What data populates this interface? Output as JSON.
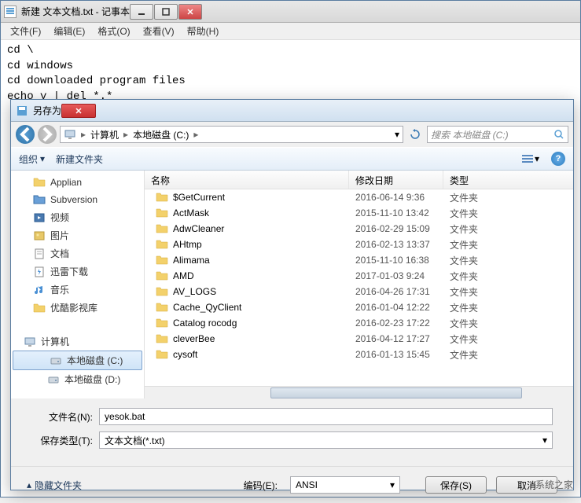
{
  "notepad": {
    "title": "新建 文本文档.txt - 记事本",
    "menu": {
      "file": "文件(F)",
      "edit": "编辑(E)",
      "format": "格式(O)",
      "view": "查看(V)",
      "help": "帮助(H)"
    },
    "content": "cd \\\ncd windows\ncd downloaded program files\necho y | del *.*"
  },
  "dialog": {
    "title": "另存为",
    "breadcrumb": {
      "computer": "计算机",
      "disk": "本地磁盘 (C:)"
    },
    "search_placeholder": "搜索 本地磁盘 (C:)",
    "toolbar": {
      "organize": "组织",
      "newfolder": "新建文件夹"
    },
    "sidebar": {
      "items": [
        {
          "label": "Applian",
          "icon": "folder"
        },
        {
          "label": "Subversion",
          "icon": "folder-blue"
        },
        {
          "label": "视频",
          "icon": "video"
        },
        {
          "label": "图片",
          "icon": "picture"
        },
        {
          "label": "文档",
          "icon": "document"
        },
        {
          "label": "迅雷下载",
          "icon": "thunder"
        },
        {
          "label": "音乐",
          "icon": "music"
        },
        {
          "label": "优酷影视库",
          "icon": "folder"
        }
      ],
      "computer": "计算机",
      "disks": [
        {
          "label": "本地磁盘 (C:)",
          "selected": true
        },
        {
          "label": "本地磁盘 (D:)",
          "selected": false
        }
      ]
    },
    "columns": {
      "name": "名称",
      "date": "修改日期",
      "type": "类型"
    },
    "files": [
      {
        "name": "$GetCurrent",
        "date": "2016-06-14 9:36",
        "type": "文件夹"
      },
      {
        "name": "ActMask",
        "date": "2015-11-10 13:42",
        "type": "文件夹"
      },
      {
        "name": "AdwCleaner",
        "date": "2016-02-29 15:09",
        "type": "文件夹"
      },
      {
        "name": "AHtmp",
        "date": "2016-02-13 13:37",
        "type": "文件夹"
      },
      {
        "name": "Alimama",
        "date": "2015-11-10 16:38",
        "type": "文件夹"
      },
      {
        "name": "AMD",
        "date": "2017-01-03 9:24",
        "type": "文件夹"
      },
      {
        "name": "AV_LOGS",
        "date": "2016-04-26 17:31",
        "type": "文件夹"
      },
      {
        "name": "Cache_QyClient",
        "date": "2016-01-04 12:22",
        "type": "文件夹"
      },
      {
        "name": "Catalog rocodg",
        "date": "2016-02-23 17:22",
        "type": "文件夹"
      },
      {
        "name": "cleverBee",
        "date": "2016-04-12 17:27",
        "type": "文件夹"
      },
      {
        "name": "cysoft",
        "date": "2016-01-13 15:45",
        "type": "文件夹"
      }
    ],
    "form": {
      "filename_label": "文件名(N):",
      "filename_value": "yesok.bat",
      "filetype_label": "保存类型(T):",
      "filetype_value": "文本文档(*.txt)",
      "hide_folders": "隐藏文件夹",
      "encoding_label": "编码(E):",
      "encoding_value": "ANSI",
      "save": "保存(S)",
      "cancel": "取消"
    }
  },
  "watermark": "系统之家"
}
